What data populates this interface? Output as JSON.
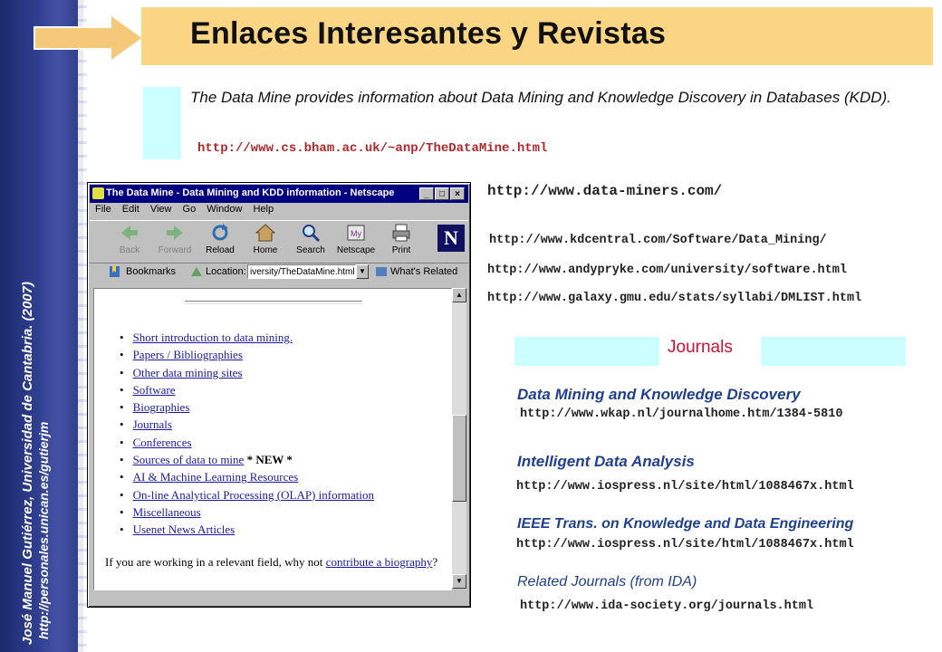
{
  "sidebar": {
    "author": "José Manuel Gutiérrez, Universidad de Cantabria. (2007)",
    "url": "http://personales.unican.es/gutierjm"
  },
  "title": "Enlaces Interesantes y Revistas",
  "intro": {
    "text": "The Data Mine provides information about Data Mining and Knowledge Discovery in Databases (KDD).",
    "url": "http://www.cs.bham.ac.uk/~anp/TheDataMine.html"
  },
  "browser": {
    "title": "The Data Mine - Data Mining and KDD information - Netscape",
    "menu": [
      "File",
      "Edit",
      "View",
      "Go",
      "Window",
      "Help"
    ],
    "toolbar": [
      "Back",
      "Forward",
      "Reload",
      "Home",
      "Search",
      "Netscape",
      "Print"
    ],
    "bookmarks_label": "Bookmarks",
    "location_label": "Location:",
    "location_value": "iversity/TheDataMine.html",
    "whats_related": "What's Related",
    "links": [
      "Short introduction to data mining.",
      "Papers / Bibliographies",
      "Other data mining sites",
      "Software",
      "Biographies",
      "Journals",
      "Conferences",
      "Sources of data to mine",
      "AI & Machine Learning Resources",
      "On-line Analytical Processing (OLAP) information",
      "Miscellaneous",
      "Usenet News Articles"
    ],
    "new_tag": "* NEW *",
    "bio_prefix": "If you are working in a relevant field, why not",
    "bio_link": "contribute a biography",
    "bio_suffix": "?"
  },
  "urls": [
    "http://www.data-miners.com/",
    "http://www.kdcentral.com/Software/Data_Mining/",
    "http://www.andypryke.com/university/software.html",
    "http://www.galaxy.gmu.edu/stats/syllabi/DMLIST.html"
  ],
  "journals": {
    "heading": "Journals",
    "items": [
      {
        "name": "Data Mining and Knowledge Discovery",
        "url": "http://www.wkap.nl/journalhome.htm/1384-5810"
      },
      {
        "name": "Intelligent Data Analysis",
        "url": "http://www.iospress.nl/site/html/1088467x.html"
      },
      {
        "name": "IEEE Trans. on Knowledge and Data Engineering",
        "url": "http://www.iospress.nl/site/html/1088467x.html"
      },
      {
        "name": "Related Journals (from IDA)",
        "url": "http://www.ida-society.org/journals.html"
      }
    ]
  }
}
